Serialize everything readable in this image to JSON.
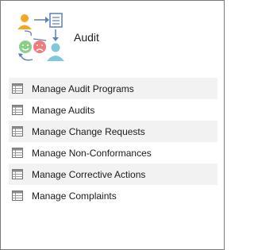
{
  "header": {
    "title": "Audit",
    "logo_icon": "audit-feedback-icon"
  },
  "menu": {
    "item_icon": "table-icon",
    "items": [
      {
        "label": "Manage Audit Programs"
      },
      {
        "label": "Manage Audits"
      },
      {
        "label": "Manage Change Requests"
      },
      {
        "label": "Manage Non-Conformances"
      },
      {
        "label": "Manage Corrective Actions"
      },
      {
        "label": "Manage Complaints"
      }
    ]
  },
  "colors": {
    "border": "#7a7a7a",
    "row_alt": "#f2f2f2",
    "person_orange": "#f5a623",
    "person_teal": "#7ec8d8",
    "smile_green": "#8ccf8a",
    "frown_red": "#ef7c7c",
    "doc_blue": "#5b7fb8"
  }
}
